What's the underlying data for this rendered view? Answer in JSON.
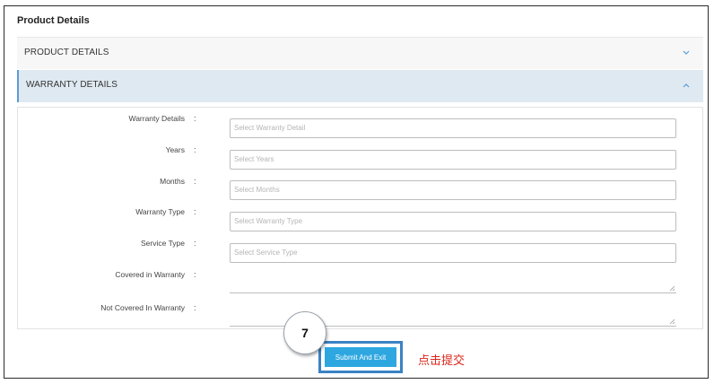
{
  "page": {
    "title": "Product Details"
  },
  "accordions": {
    "product": {
      "label": "PRODUCT DETAILS",
      "state": "collapsed"
    },
    "warranty": {
      "label": "WARRANTY DETAILS",
      "state": "expanded"
    }
  },
  "form": {
    "colon": ":",
    "fields": [
      {
        "label": "Warranty Details",
        "placeholder": "Select Warranty Detail"
      },
      {
        "label": "Years",
        "placeholder": "Select Years"
      },
      {
        "label": "Months",
        "placeholder": "Select Months"
      },
      {
        "label": "Warranty Type",
        "placeholder": "Select Warranty Type"
      },
      {
        "label": "Service Type",
        "placeholder": "Select Service Type"
      }
    ],
    "textareas": [
      {
        "label": "Covered in Warranty"
      },
      {
        "label": "Not Covered In Warranty"
      }
    ]
  },
  "actions": {
    "submit_label": "Submit And Exit"
  },
  "annotation": {
    "step_number": "7",
    "note": "点击提交"
  },
  "colors": {
    "accent": "#2ea7e0",
    "highlight": "#3b82c4",
    "note": "#d9241a",
    "accordion_active": "#dfe9f1"
  }
}
